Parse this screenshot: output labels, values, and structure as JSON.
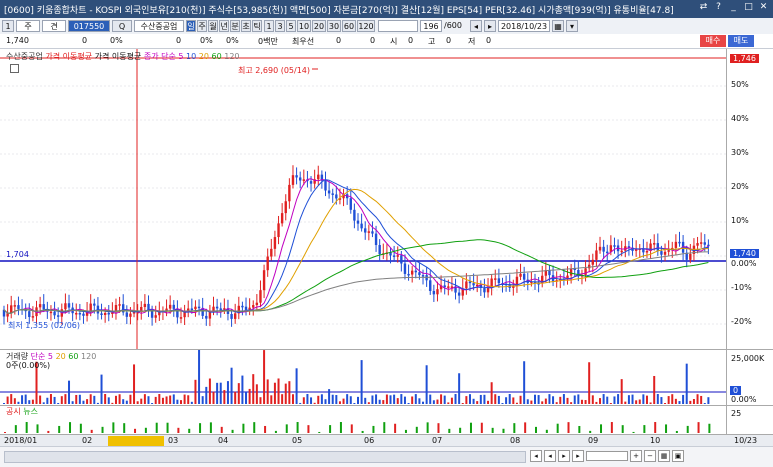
{
  "window": {
    "title": "[0600] 키움종합차트 - KOSPI 외국인보유[210(천)] 주식수[53,985(천)] 액면[500] 자본금[270(억)] 결산[12월] EPS[54] PER[32.46] 시가총액[939(억)] 유통비율[47.8]"
  },
  "toolbar": {
    "menu": "1",
    "period_unit": "주",
    "period_value": "견",
    "code": "017550",
    "stock_name": "수산중공업",
    "periods": [
      "일",
      "주",
      "월",
      "년",
      "분",
      "초",
      "틱"
    ],
    "selected_period": "일",
    "minutes": [
      "1",
      "3",
      "5",
      "10",
      "20",
      "30",
      "60",
      "120"
    ],
    "count": "196",
    "total": "/600",
    "date": "2018/10/23"
  },
  "info": {
    "price": "1,740",
    "change": "0",
    "pct": "0%",
    "vol": "0",
    "vol_pct": "0%",
    "amount": "0%",
    "amount_unit": "0백만",
    "best_ask": "최우선",
    "ask": "0",
    "ask2": "0",
    "high_label": "시",
    "high": "0",
    "low_label": "고",
    "low": "0",
    "close_label": "저",
    "close": "0",
    "buy_label": "매수",
    "sell_label": "매도"
  },
  "legend": {
    "name": "수산중공업",
    "ma_label": "가격 이동평균",
    "ma2_label": "가격 이동평균",
    "vol_ma_label": "종가 단순",
    "ma_periods": [
      "5",
      "10",
      "20",
      "60",
      "120"
    ]
  },
  "price_pane": {
    "high_note": "최고 2,690 (05/14)",
    "low_note": "최저 1,355 (02/06)",
    "current_price": "1,746",
    "ref_price": "1,704",
    "ref_price_right": "1,740",
    "ref_pct": "0.00%",
    "y_ticks": [
      "50%",
      "40%",
      "30%",
      "20%",
      "10%",
      "0.00%",
      "-10%",
      "-20%"
    ]
  },
  "volume_pane": {
    "label": "거래량",
    "ma_label": "단순",
    "ma_periods": [
      "5",
      "20",
      "60",
      "120"
    ],
    "value_text": "0주(0.00%)",
    "y_tick": "25,000K",
    "current": "0",
    "pct": "0.00%"
  },
  "news_pane": {
    "label1": "공시",
    "label2": "뉴스",
    "y_tick": "25"
  },
  "date_axis": [
    "2018/01",
    "02",
    "03",
    "04",
    "05",
    "06",
    "07",
    "08",
    "09",
    "10",
    "10/23"
  ],
  "colors": {
    "up": "#e02020",
    "down": "#1f4fd6",
    "ma5": "#c000c0",
    "ma10": "#1f4fd6",
    "ma20": "#e0a000",
    "ma60": "#10a010",
    "ma120": "#808080",
    "ref_line": "#1010c0",
    "accent": "#2b5fb8"
  }
}
